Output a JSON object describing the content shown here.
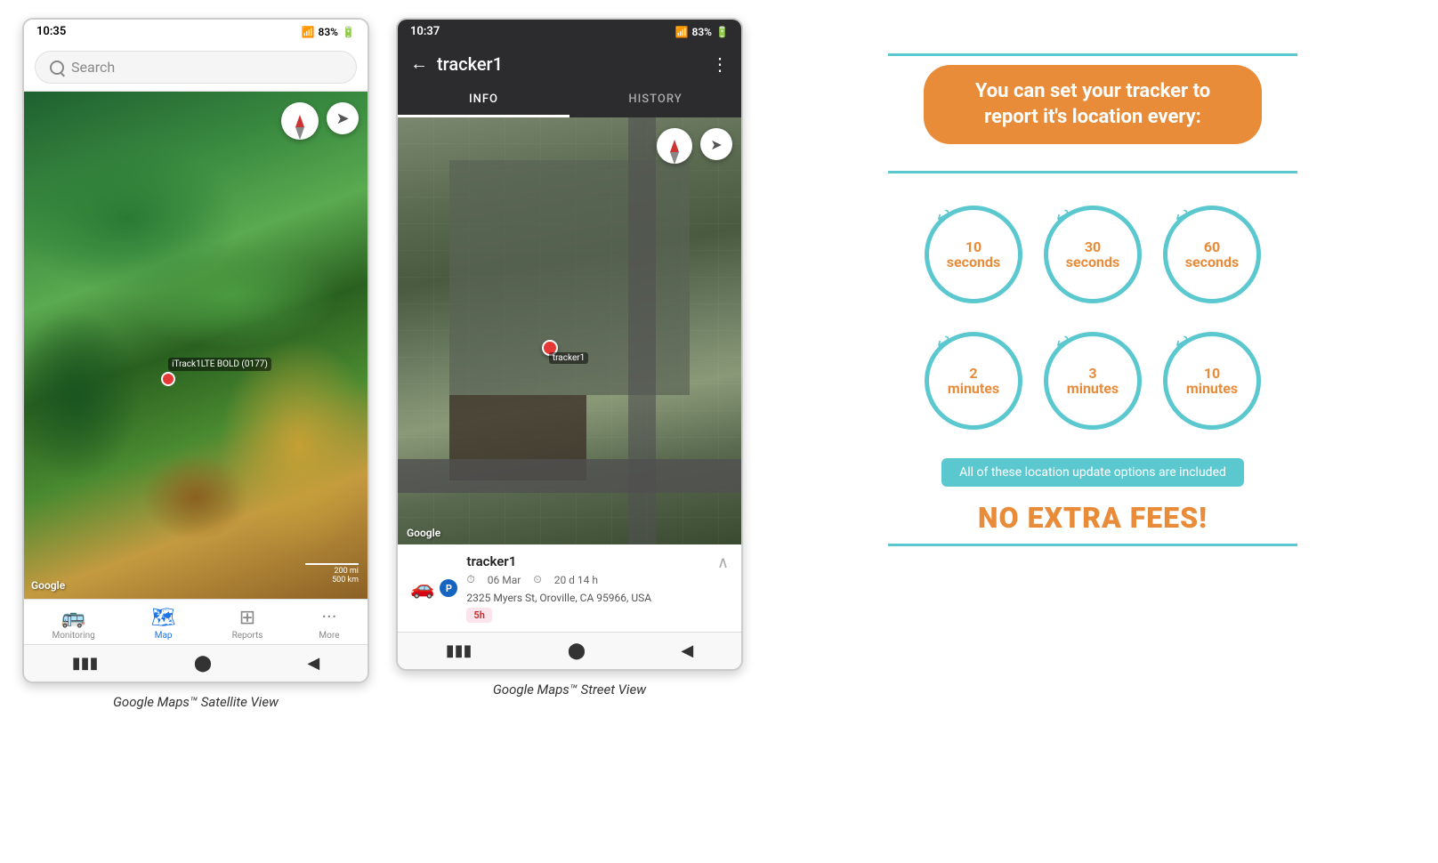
{
  "phone1": {
    "status_bar": {
      "time": "10:35",
      "signal": "▲▲▲",
      "network": ".al",
      "battery": "83%"
    },
    "search": {
      "placeholder": "Search"
    },
    "map": {
      "tracker_label": "iTrack1LTE BOLD (0177)",
      "watermark": "Google",
      "scale_line1": "200 mi",
      "scale_line2": "500 km"
    },
    "nav": {
      "items": [
        {
          "label": "Monitoring",
          "icon": "🚌",
          "active": false
        },
        {
          "label": "Map",
          "icon": "🗺",
          "active": true
        },
        {
          "label": "Reports",
          "icon": "⊞",
          "active": false
        },
        {
          "label": "More",
          "icon": "···",
          "active": false
        }
      ]
    },
    "caption": "Google Maps™ Satellite View"
  },
  "phone2": {
    "status_bar": {
      "time": "10:37",
      "signal": "▲▲▲",
      "network": ".al",
      "battery": "83%"
    },
    "header": {
      "back_label": "←",
      "title": "tracker1",
      "more_label": "⋮"
    },
    "tabs": [
      {
        "label": "INFO",
        "active": true
      },
      {
        "label": "HISTORY",
        "active": false
      }
    ],
    "map": {
      "watermark": "Google",
      "tracker_label": "tracker1"
    },
    "info_panel": {
      "tracker_name": "tracker1",
      "date": "06 Mar",
      "duration": "20 d 14 h",
      "address": "2325 Myers St, Oroville, CA 95966, USA",
      "badge": "5h"
    },
    "caption": "Google Maps™ Street View"
  },
  "info_graphic": {
    "title": "You can set your tracker to report it's location every:",
    "circles": [
      {
        "number": "10",
        "unit": "seconds"
      },
      {
        "number": "30",
        "unit": "seconds"
      },
      {
        "number": "60",
        "unit": "seconds"
      },
      {
        "number": "2",
        "unit": "minutes"
      },
      {
        "number": "3",
        "unit": "minutes"
      },
      {
        "number": "10",
        "unit": "minutes"
      }
    ],
    "included_text": "All of these location update options are included",
    "no_fees": "NO EXTRA FEES!"
  }
}
